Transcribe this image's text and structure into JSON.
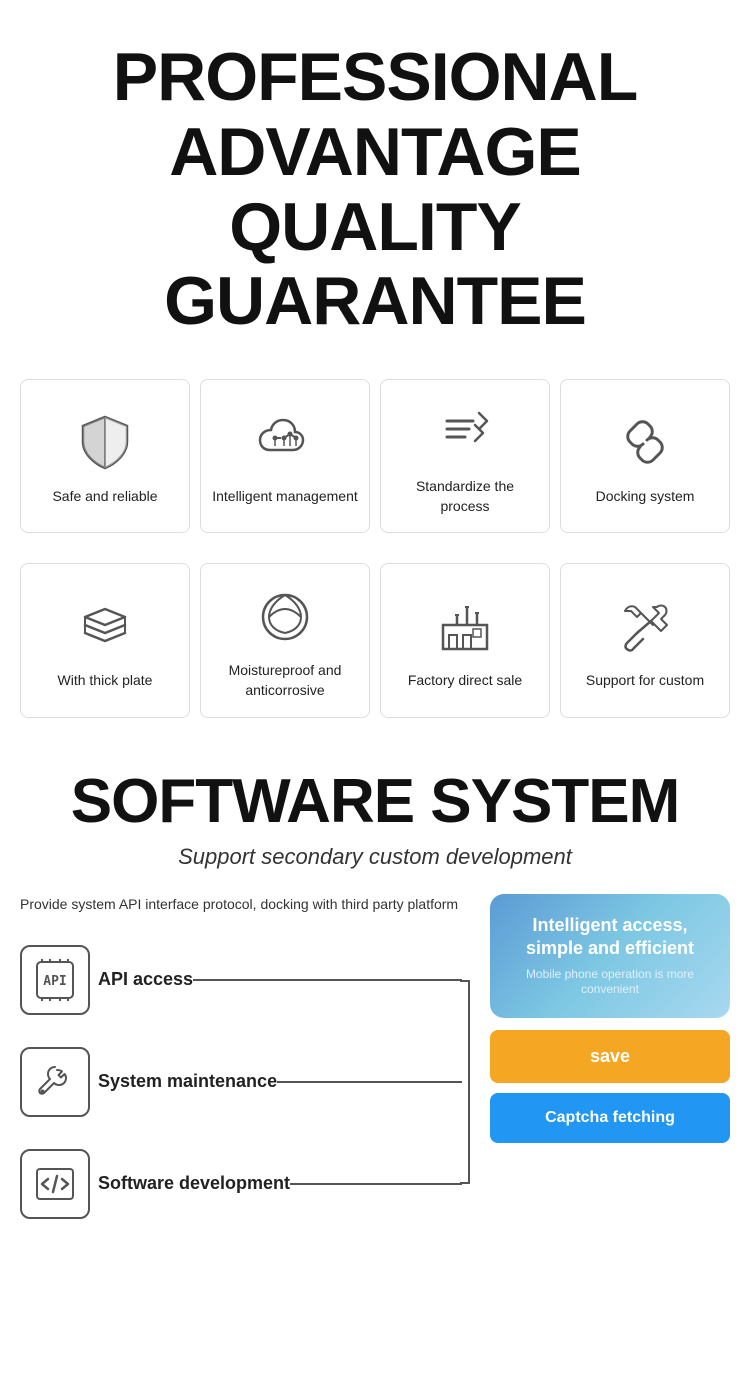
{
  "header": {
    "line1": "PROFESSIONAL",
    "line2": "ADVANTAGE",
    "line3": "QUALITY GUARANTEE"
  },
  "row1_features": [
    {
      "id": "safe-reliable",
      "label": "Safe and reliable",
      "icon": "shield"
    },
    {
      "id": "intelligent-management",
      "label": "Intelligent management",
      "icon": "cloud"
    },
    {
      "id": "standardize-process",
      "label": "Standardize the process",
      "icon": "arrow-list"
    },
    {
      "id": "docking-system",
      "label": "Docking system",
      "icon": "link"
    }
  ],
  "row2_features": [
    {
      "id": "thick-plate",
      "label": "With thick plate",
      "icon": "layers"
    },
    {
      "id": "moistureproof",
      "label": "Moistureproof and anticorrosive",
      "icon": "leaf"
    },
    {
      "id": "factory-sale",
      "label": "Factory direct sale",
      "icon": "factory"
    },
    {
      "id": "support-custom",
      "label": "Support for custom",
      "icon": "tools"
    }
  ],
  "software": {
    "title": "SOFTWARE SYSTEM",
    "subtitle": "Support secondary custom development",
    "description": "Provide system API interface protocol, docking with third party platform",
    "items": [
      {
        "id": "api",
        "label": "API access",
        "icon": "api"
      },
      {
        "id": "maintenance",
        "label": "System maintenance",
        "icon": "wrench"
      },
      {
        "id": "dev",
        "label": "Software development",
        "icon": "code"
      }
    ],
    "phone": {
      "main_text": "Intelligent access, simple and efficient",
      "sub_text": "Mobile phone operation is more convenient"
    },
    "btn_save": "save",
    "btn_captcha": "Captcha fetching"
  }
}
